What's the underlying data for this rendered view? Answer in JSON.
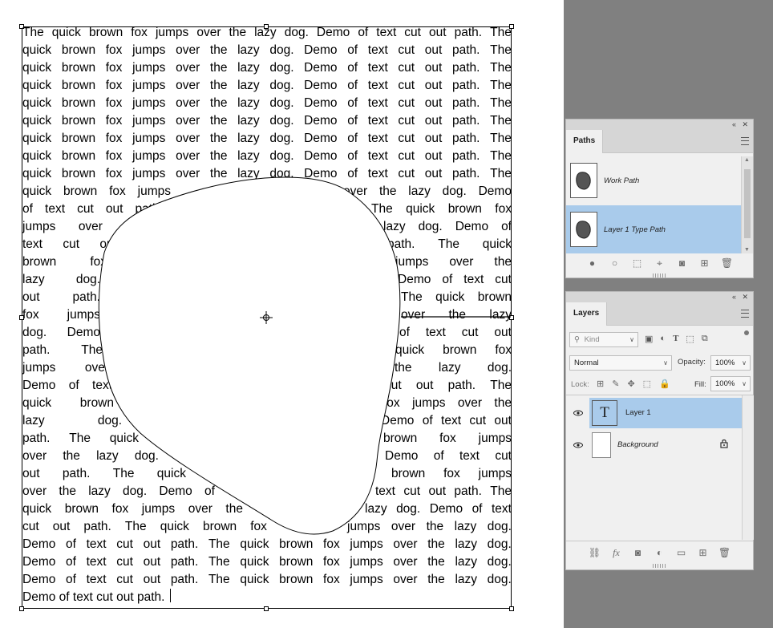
{
  "document": {
    "full_line": "The quick brown fox jumps over the lazy dog. Demo of text cut out path.",
    "line1": [
      "The",
      "quick",
      "brown",
      "fox",
      "jumps",
      "over",
      "the",
      "lazy",
      "dog.",
      "Demo",
      "of",
      "text",
      "cut",
      "out",
      "path.",
      "The"
    ],
    "line2": [
      "quick",
      "brown",
      "fox",
      "jumps",
      "over",
      "the",
      "lazy",
      "dog.",
      "Demo",
      "of",
      "text",
      "cut",
      "out",
      "path.",
      "The"
    ],
    "wrapped_lines": [
      [
        [
          "quick",
          "brown",
          "fox",
          "jumps"
        ],
        [
          "over",
          "the",
          "lazy",
          "dog.",
          "Demo"
        ]
      ],
      [
        [
          "of",
          "text",
          "cut",
          "out",
          "path."
        ],
        [
          "The",
          "quick",
          "brown",
          "fox"
        ]
      ],
      [
        [
          "jumps",
          "over",
          "the"
        ],
        [
          "lazy",
          "dog.",
          "Demo",
          "of"
        ]
      ],
      [
        [
          "text",
          "cut",
          "out"
        ],
        [
          "path.",
          "The",
          "quick"
        ]
      ],
      [
        [
          "brown",
          "fox"
        ],
        [
          "jumps",
          "over",
          "the"
        ]
      ],
      [
        [
          "lazy",
          "dog."
        ],
        [
          "Demo",
          "of",
          "text",
          "cut"
        ]
      ],
      [
        [
          "out",
          "path."
        ],
        [
          "The",
          "quick",
          "brown"
        ]
      ],
      [
        [
          "fox",
          "jumps"
        ],
        [
          "over",
          "the",
          "lazy"
        ]
      ],
      [
        [
          "dog.",
          "Demo"
        ],
        [
          "of",
          "text",
          "cut",
          "out"
        ]
      ],
      [
        [
          "path.",
          "The"
        ],
        [
          "quick",
          "brown",
          "fox"
        ]
      ],
      [
        [
          "jumps",
          "over"
        ],
        [
          "the",
          "lazy",
          "dog."
        ]
      ],
      [
        [
          "Demo",
          "of",
          "text"
        ],
        [
          "cut",
          "out",
          "path.",
          "The"
        ]
      ],
      [
        [
          "quick",
          "brown"
        ],
        [
          "fox",
          "jumps",
          "over",
          "the"
        ]
      ],
      [
        [
          "lazy",
          "dog."
        ],
        [
          "Demo",
          "of",
          "text",
          "cut",
          "out"
        ]
      ],
      [
        [
          "path.",
          "The",
          "quick"
        ],
        [
          "brown",
          "fox",
          "jumps"
        ]
      ],
      [
        [
          "over",
          "the",
          "lazy",
          "dog."
        ],
        [
          "Demo",
          "of",
          "text",
          "cut"
        ]
      ],
      [
        [
          "out",
          "path.",
          "The",
          "quick"
        ],
        [
          "brown",
          "fox",
          "jumps"
        ]
      ],
      [
        [
          "over",
          "the",
          "lazy",
          "dog.",
          "Demo",
          "of"
        ],
        [
          "text",
          "cut",
          "out",
          "path.",
          "The"
        ]
      ],
      [
        [
          "quick",
          "brown",
          "fox",
          "jumps",
          "over",
          "the"
        ],
        [
          "lazy",
          "dog.",
          "Demo",
          "of",
          "text"
        ]
      ],
      [
        [
          "cut",
          "out",
          "path.",
          "The",
          "quick",
          "brown",
          "fox"
        ],
        [
          "jumps",
          "over",
          "the",
          "lazy",
          "dog."
        ]
      ]
    ],
    "tail_line": [
      "Demo",
      "of",
      "text",
      "cut",
      "out",
      "path.",
      "The",
      "quick",
      "brown",
      "fox",
      "jumps",
      "over",
      "the",
      "lazy",
      "dog."
    ],
    "last_line": "Demo of text cut out path."
  },
  "paths_panel": {
    "tab": "Paths",
    "items": [
      {
        "label": "Work Path",
        "selected": false
      },
      {
        "label": "Layer 1 Type Path",
        "selected": true
      }
    ]
  },
  "layers_panel": {
    "tab": "Layers",
    "filter_placeholder": "Kind",
    "blend_mode": "Normal",
    "opacity_label": "Opacity:",
    "opacity_value": "100%",
    "lock_label": "Lock:",
    "fill_label": "Fill:",
    "fill_value": "100%",
    "layers": [
      {
        "name": "Layer 1",
        "type_glyph": "T",
        "selected": true
      },
      {
        "name": "Background",
        "selected": false
      }
    ]
  },
  "colors": {
    "selection": "#a9cbeb",
    "pasteboard": "#808080",
    "panel_bg": "#f0f0f0"
  }
}
